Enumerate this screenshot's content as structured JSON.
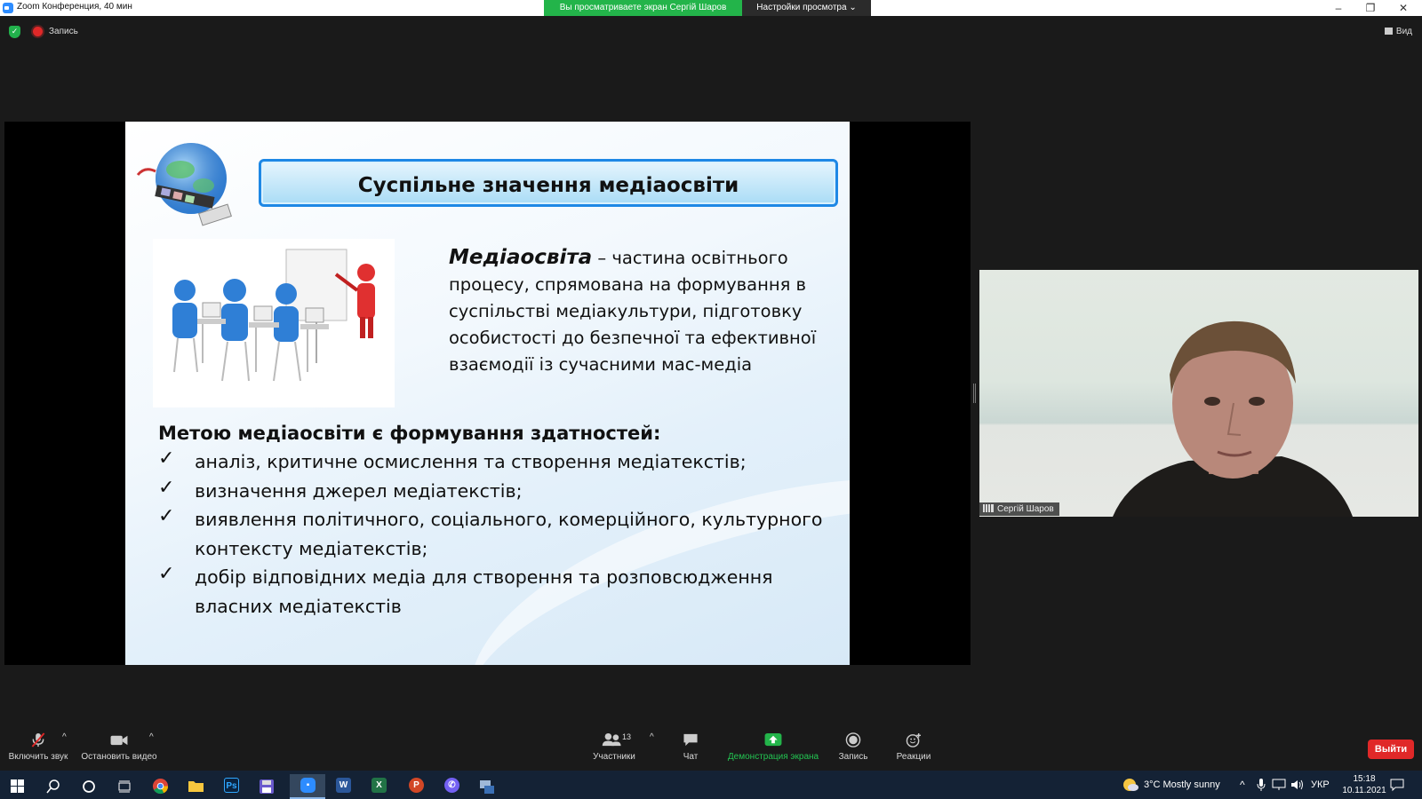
{
  "window": {
    "title": "Zoom Конференция, 40 мин",
    "share_banner": "Вы просматриваете экран Сергій Шаров",
    "view_options": "Настройки просмотра ⌄",
    "minimize": "–",
    "restore": "❐",
    "close": "✕"
  },
  "topbar": {
    "recording": "Запись",
    "view": "Вид"
  },
  "slide": {
    "title": "Суспільне значення медіаосвіти",
    "definition_term": "Медіаосвіта",
    "definition_text": " – частина освітнього процесу, спрямована на формування в суспільстві медіакультури, підготовку особистості до безпечної та ефективної взаємодії із сучасними мас-медіа",
    "goals_heading": "Метою медіаосвіти є формування здатностей:",
    "check": "✓",
    "goals": [
      "аналіз, критичне осмислення та створення медіатекстів;",
      "визначення джерел медіатекстів;",
      "виявлення політичного, соціального, комерційного, культурного контексту медіатекстів;",
      "добір відповідних медіа для створення та розповсюдження власних медіатекстів"
    ]
  },
  "speaker": {
    "name": "Сергій Шаров"
  },
  "toolbar": {
    "unmute": "Включить звук",
    "stop_video": "Остановить видео",
    "participants": "Участники",
    "participants_count": "13",
    "chat": "Чат",
    "share_screen": "Демонстрация экрана",
    "record": "Запись",
    "reactions": "Реакции",
    "exit": "Выйти",
    "caret": "^"
  },
  "taskbar": {
    "weather": "3°C  Mostly sunny",
    "language": "УКР",
    "time": "15:18",
    "date": "10.11.2021",
    "apps": [
      "start",
      "search",
      "cortana",
      "task-view",
      "chrome",
      "explorer",
      "photoshop",
      "save",
      "zoom",
      "word",
      "excel",
      "powerpoint",
      "viber",
      "other"
    ],
    "labels": {
      "ps": "Ps",
      "word": "W",
      "excel": "X",
      "ppt": "P"
    }
  },
  "colors": {
    "share_green": "#23b44a",
    "exit_red": "#e02828",
    "title_border": "#1e88e5",
    "taskbar": "#142235"
  }
}
